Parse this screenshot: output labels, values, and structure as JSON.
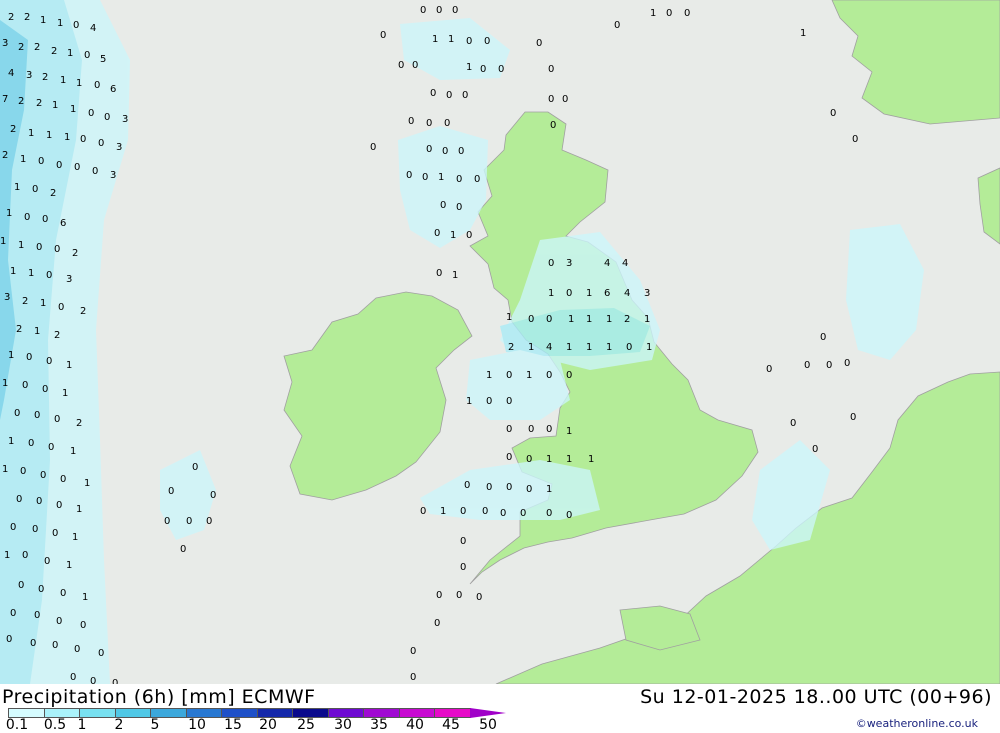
{
  "header": {
    "title": "Precipitation (6h) [mm] ECMWF",
    "valid_time": "Su 12-01-2025 18..00 UTC (00+96)"
  },
  "legend": {
    "labels": [
      "0.1",
      "0.5",
      "1",
      "2",
      "5",
      "10",
      "15",
      "20",
      "25",
      "30",
      "35",
      "40",
      "45",
      "50"
    ],
    "colors": [
      "#d6fcff",
      "#aaf2fa",
      "#78e0f0",
      "#50c8e6",
      "#3ca8dc",
      "#2878d2",
      "#1e50c8",
      "#1428aa",
      "#0a0a8c",
      "#6e0ad2",
      "#a00ad2",
      "#c80ad2",
      "#e60ac8",
      "#a000c8"
    ]
  },
  "credit": "©weatheronline.co.uk",
  "colors": {
    "sea": "#e8ebe8",
    "land": "#b4ec98",
    "border": "#a0a0a0",
    "precip_light": "#ccf6fb",
    "precip_mid": "#a8ecf7",
    "precip_heavy": "#6ed2ec"
  },
  "map_values": [
    {
      "t": "2"
    },
    {
      "t": "2"
    },
    {
      "t": "1"
    },
    {
      "t": "1"
    },
    {
      "t": "0"
    },
    {
      "t": "4"
    },
    {
      "t": "3"
    },
    {
      "t": "2"
    },
    {
      "t": "2"
    },
    {
      "t": "2"
    },
    {
      "t": "1"
    },
    {
      "t": "0"
    },
    {
      "t": "5"
    },
    {
      "t": "4"
    },
    {
      "t": "3"
    },
    {
      "t": "2"
    },
    {
      "t": "1"
    },
    {
      "t": "1"
    },
    {
      "t": "0"
    },
    {
      "t": "6"
    },
    {
      "t": "7"
    },
    {
      "t": "2"
    },
    {
      "t": "2"
    },
    {
      "t": "1"
    },
    {
      "t": "1"
    },
    {
      "t": "0"
    },
    {
      "t": "0"
    },
    {
      "t": "3"
    },
    {
      "t": "2"
    },
    {
      "t": "1"
    },
    {
      "t": "1"
    },
    {
      "t": "1"
    },
    {
      "t": "0"
    },
    {
      "t": "0"
    },
    {
      "t": "3"
    },
    {
      "t": "2"
    },
    {
      "t": "1"
    },
    {
      "t": "0"
    },
    {
      "t": "0"
    },
    {
      "t": "0"
    },
    {
      "t": "0"
    },
    {
      "t": "3"
    },
    {
      "t": "1"
    },
    {
      "t": "0"
    },
    {
      "t": "2"
    },
    {
      "t": "1"
    },
    {
      "t": "0"
    },
    {
      "t": "0"
    },
    {
      "t": "6"
    },
    {
      "t": "1"
    },
    {
      "t": "1"
    },
    {
      "t": "0"
    },
    {
      "t": "0"
    },
    {
      "t": "2"
    },
    {
      "t": "1"
    },
    {
      "t": "1"
    },
    {
      "t": "0"
    },
    {
      "t": "3"
    },
    {
      "t": "3"
    },
    {
      "t": "2"
    },
    {
      "t": "1"
    },
    {
      "t": "0"
    },
    {
      "t": "2"
    },
    {
      "t": "2"
    },
    {
      "t": "1"
    },
    {
      "t": "2"
    },
    {
      "t": "1"
    },
    {
      "t": "0"
    },
    {
      "t": "0"
    },
    {
      "t": "1"
    },
    {
      "t": "1"
    },
    {
      "t": "0"
    },
    {
      "t": "0"
    },
    {
      "t": "1"
    },
    {
      "t": "0"
    },
    {
      "t": "0"
    },
    {
      "t": "0"
    },
    {
      "t": "2"
    },
    {
      "t": "1"
    },
    {
      "t": "0"
    },
    {
      "t": "0"
    },
    {
      "t": "1"
    },
    {
      "t": "1"
    },
    {
      "t": "0"
    },
    {
      "t": "0"
    },
    {
      "t": "0"
    },
    {
      "t": "1"
    },
    {
      "t": "0"
    },
    {
      "t": "0"
    },
    {
      "t": "0"
    },
    {
      "t": "1"
    },
    {
      "t": "0"
    },
    {
      "t": "0"
    },
    {
      "t": "0"
    },
    {
      "t": "1"
    },
    {
      "t": "1"
    },
    {
      "t": "0"
    },
    {
      "t": "0"
    },
    {
      "t": "1"
    },
    {
      "t": "0"
    },
    {
      "t": "0"
    },
    {
      "t": "0"
    },
    {
      "t": "1"
    },
    {
      "t": "0"
    },
    {
      "t": "0"
    },
    {
      "t": "0"
    },
    {
      "t": "0"
    },
    {
      "t": "0"
    },
    {
      "t": "0"
    },
    {
      "t": "0"
    },
    {
      "t": "0"
    },
    {
      "t": "0"
    },
    {
      "t": "0"
    },
    {
      "t": "0"
    },
    {
      "t": "0"
    },
    {
      "t": "0"
    },
    {
      "t": "0"
    },
    {
      "t": "0"
    },
    {
      "t": "1"
    },
    {
      "t": "1"
    },
    {
      "t": "0"
    },
    {
      "t": "0"
    },
    {
      "t": "0"
    },
    {
      "t": "0"
    },
    {
      "t": "1"
    },
    {
      "t": "0"
    },
    {
      "t": "0"
    },
    {
      "t": "0"
    },
    {
      "t": "0"
    },
    {
      "t": "0"
    },
    {
      "t": "0"
    },
    {
      "t": "0"
    },
    {
      "t": "0"
    },
    {
      "t": "0"
    },
    {
      "t": "0"
    },
    {
      "t": "0"
    },
    {
      "t": "0"
    },
    {
      "t": "0"
    },
    {
      "t": "1"
    },
    {
      "t": "0"
    },
    {
      "t": "0"
    },
    {
      "t": "0"
    },
    {
      "t": "0"
    },
    {
      "t": "0"
    },
    {
      "t": "1"
    },
    {
      "t": "0"
    },
    {
      "t": "0"
    },
    {
      "t": "1"
    },
    {
      "t": "0"
    },
    {
      "t": "0"
    },
    {
      "t": "0"
    },
    {
      "t": "0"
    },
    {
      "t": "0"
    },
    {
      "t": "0"
    },
    {
      "t": "0"
    },
    {
      "t": "1"
    },
    {
      "t": "0"
    },
    {
      "t": "0"
    },
    {
      "t": "0"
    },
    {
      "t": "1"
    },
    {
      "t": "0"
    },
    {
      "t": "0"
    },
    {
      "t": "0"
    },
    {
      "t": "3"
    },
    {
      "t": "4"
    },
    {
      "t": "4"
    },
    {
      "t": "1"
    },
    {
      "t": "0"
    },
    {
      "t": "0"
    },
    {
      "t": "1"
    },
    {
      "t": "1"
    },
    {
      "t": "1"
    },
    {
      "t": "2"
    },
    {
      "t": "1"
    },
    {
      "t": "1"
    },
    {
      "t": "0"
    },
    {
      "t": "1"
    },
    {
      "t": "6"
    },
    {
      "t": "4"
    },
    {
      "t": "3"
    },
    {
      "t": "2"
    },
    {
      "t": "1"
    },
    {
      "t": "4"
    },
    {
      "t": "1"
    },
    {
      "t": "1"
    },
    {
      "t": "1"
    },
    {
      "t": "0"
    },
    {
      "t": "1"
    },
    {
      "t": "1"
    },
    {
      "t": "0"
    },
    {
      "t": "1"
    },
    {
      "t": "0"
    },
    {
      "t": "0"
    },
    {
      "t": "1"
    },
    {
      "t": "0"
    },
    {
      "t": "0"
    },
    {
      "t": "0"
    },
    {
      "t": "0"
    },
    {
      "t": "0"
    },
    {
      "t": "1"
    },
    {
      "t": "0"
    },
    {
      "t": "0"
    },
    {
      "t": "1"
    },
    {
      "t": "1"
    },
    {
      "t": "1"
    },
    {
      "t": "0"
    },
    {
      "t": "0"
    },
    {
      "t": "0"
    },
    {
      "t": "0"
    },
    {
      "t": "1"
    },
    {
      "t": "0"
    },
    {
      "t": "1"
    },
    {
      "t": "0"
    },
    {
      "t": "0"
    },
    {
      "t": "0"
    },
    {
      "t": "0"
    },
    {
      "t": "0"
    },
    {
      "t": "0"
    },
    {
      "t": "0"
    },
    {
      "t": "0"
    },
    {
      "t": "0"
    },
    {
      "t": "0"
    },
    {
      "t": "0"
    },
    {
      "t": "0"
    },
    {
      "t": "0"
    },
    {
      "t": "0"
    },
    {
      "t": "0"
    },
    {
      "t": "0"
    },
    {
      "t": "0"
    },
    {
      "t": "0"
    },
    {
      "t": "0"
    },
    {
      "t": "0"
    },
    {
      "t": "0"
    },
    {
      "t": "0"
    },
    {
      "t": "0"
    },
    {
      "t": "0"
    },
    {
      "t": "0"
    },
    {
      "t": "0"
    },
    {
      "t": "0"
    },
    {
      "t": "0"
    },
    {
      "t": "0"
    }
  ]
}
